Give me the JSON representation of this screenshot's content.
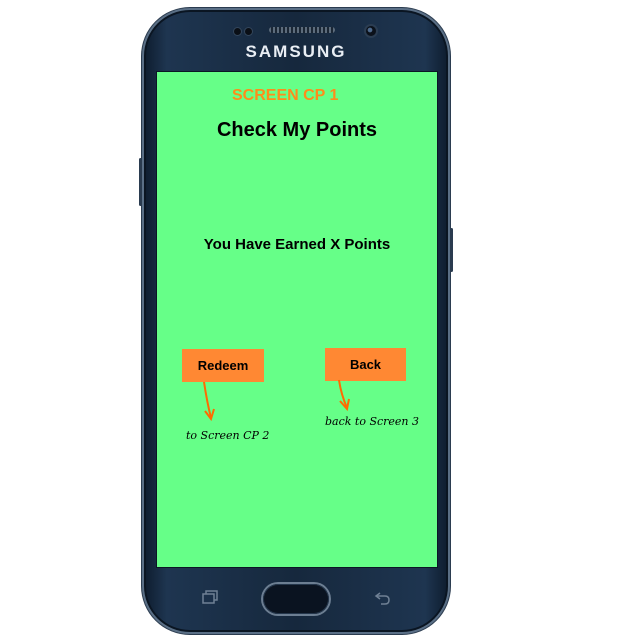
{
  "device": {
    "brand": "SAMSUNG",
    "icons": {
      "recent_apps": "recent-apps-icon",
      "back": "back-icon",
      "home": "home-button"
    }
  },
  "screen": {
    "label": "SCREEN CP 1",
    "title": "Check My Points",
    "points_message": "You Have Earned X Points",
    "background_color": "#66ff88",
    "accent_color": "#ff8833"
  },
  "buttons": {
    "redeem": {
      "label": "Redeem",
      "annotation": "to Screen CP 2"
    },
    "back": {
      "label": "Back",
      "annotation": "back to Screen 3"
    }
  }
}
